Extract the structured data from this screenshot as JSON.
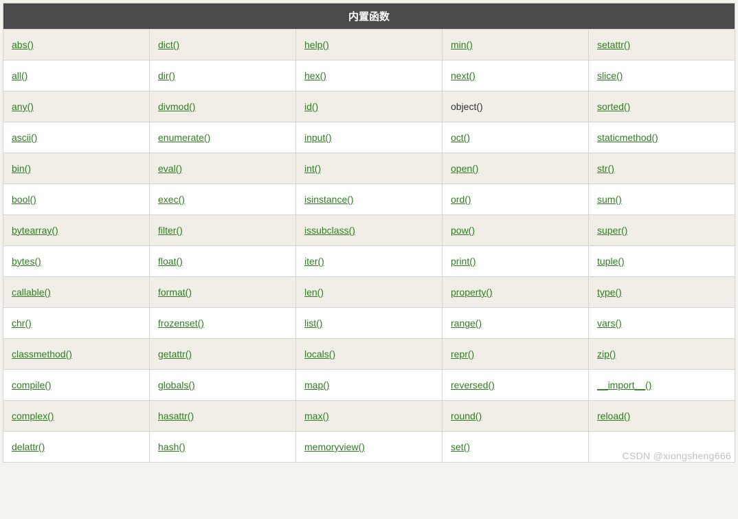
{
  "header": "内置函数",
  "rows": [
    [
      {
        "t": "abs()",
        "l": true
      },
      {
        "t": "dict()",
        "l": true
      },
      {
        "t": "help()",
        "l": true
      },
      {
        "t": "min()",
        "l": true
      },
      {
        "t": "setattr()",
        "l": true
      }
    ],
    [
      {
        "t": "all()",
        "l": true
      },
      {
        "t": "dir()",
        "l": true
      },
      {
        "t": "hex()",
        "l": true
      },
      {
        "t": "next()",
        "l": true
      },
      {
        "t": "slice()",
        "l": true
      }
    ],
    [
      {
        "t": "any()",
        "l": true
      },
      {
        "t": "divmod()",
        "l": true
      },
      {
        "t": "id()",
        "l": true
      },
      {
        "t": "object()",
        "l": false
      },
      {
        "t": "sorted()",
        "l": true
      }
    ],
    [
      {
        "t": "ascii()",
        "l": true
      },
      {
        "t": "enumerate()",
        "l": true
      },
      {
        "t": "input()",
        "l": true
      },
      {
        "t": "oct()",
        "l": true
      },
      {
        "t": "staticmethod()",
        "l": true
      }
    ],
    [
      {
        "t": "bin()",
        "l": true
      },
      {
        "t": "eval()",
        "l": true
      },
      {
        "t": "int()",
        "l": true
      },
      {
        "t": "open()",
        "l": true
      },
      {
        "t": "str()",
        "l": true
      }
    ],
    [
      {
        "t": "bool()",
        "l": true
      },
      {
        "t": "exec()",
        "l": true
      },
      {
        "t": "isinstance()",
        "l": true
      },
      {
        "t": "ord()",
        "l": true
      },
      {
        "t": "sum()",
        "l": true
      }
    ],
    [
      {
        "t": "bytearray()",
        "l": true
      },
      {
        "t": "filter()",
        "l": true
      },
      {
        "t": "issubclass()",
        "l": true
      },
      {
        "t": "pow()",
        "l": true
      },
      {
        "t": "super()",
        "l": true
      }
    ],
    [
      {
        "t": "bytes()",
        "l": true
      },
      {
        "t": "float()",
        "l": true
      },
      {
        "t": "iter()",
        "l": true
      },
      {
        "t": "print()",
        "l": true
      },
      {
        "t": "tuple()",
        "l": true
      }
    ],
    [
      {
        "t": "callable()",
        "l": true
      },
      {
        "t": "format()",
        "l": true
      },
      {
        "t": "len()",
        "l": true
      },
      {
        "t": "property()",
        "l": true
      },
      {
        "t": "type()",
        "l": true
      }
    ],
    [
      {
        "t": "chr()",
        "l": true
      },
      {
        "t": "frozenset()",
        "l": true
      },
      {
        "t": "list()",
        "l": true
      },
      {
        "t": "range()",
        "l": true
      },
      {
        "t": "vars()",
        "l": true
      }
    ],
    [
      {
        "t": "classmethod()",
        "l": true
      },
      {
        "t": "getattr()",
        "l": true
      },
      {
        "t": "locals()",
        "l": true
      },
      {
        "t": "repr()",
        "l": true
      },
      {
        "t": "zip()",
        "l": true
      }
    ],
    [
      {
        "t": "compile()",
        "l": true
      },
      {
        "t": "globals()",
        "l": true
      },
      {
        "t": "map()",
        "l": true
      },
      {
        "t": "reversed()",
        "l": true
      },
      {
        "t": "__import__()",
        "l": true
      }
    ],
    [
      {
        "t": "complex()",
        "l": true
      },
      {
        "t": "hasattr()",
        "l": true
      },
      {
        "t": "max()",
        "l": true
      },
      {
        "t": "round()",
        "l": true
      },
      {
        "t": "reload()",
        "l": true
      }
    ],
    [
      {
        "t": "delattr()",
        "l": true
      },
      {
        "t": "hash()",
        "l": true
      },
      {
        "t": "memoryview()",
        "l": true
      },
      {
        "t": "set()",
        "l": true
      },
      {
        "t": "",
        "l": false
      }
    ]
  ],
  "watermark": "CSDN @xiongsheng666"
}
